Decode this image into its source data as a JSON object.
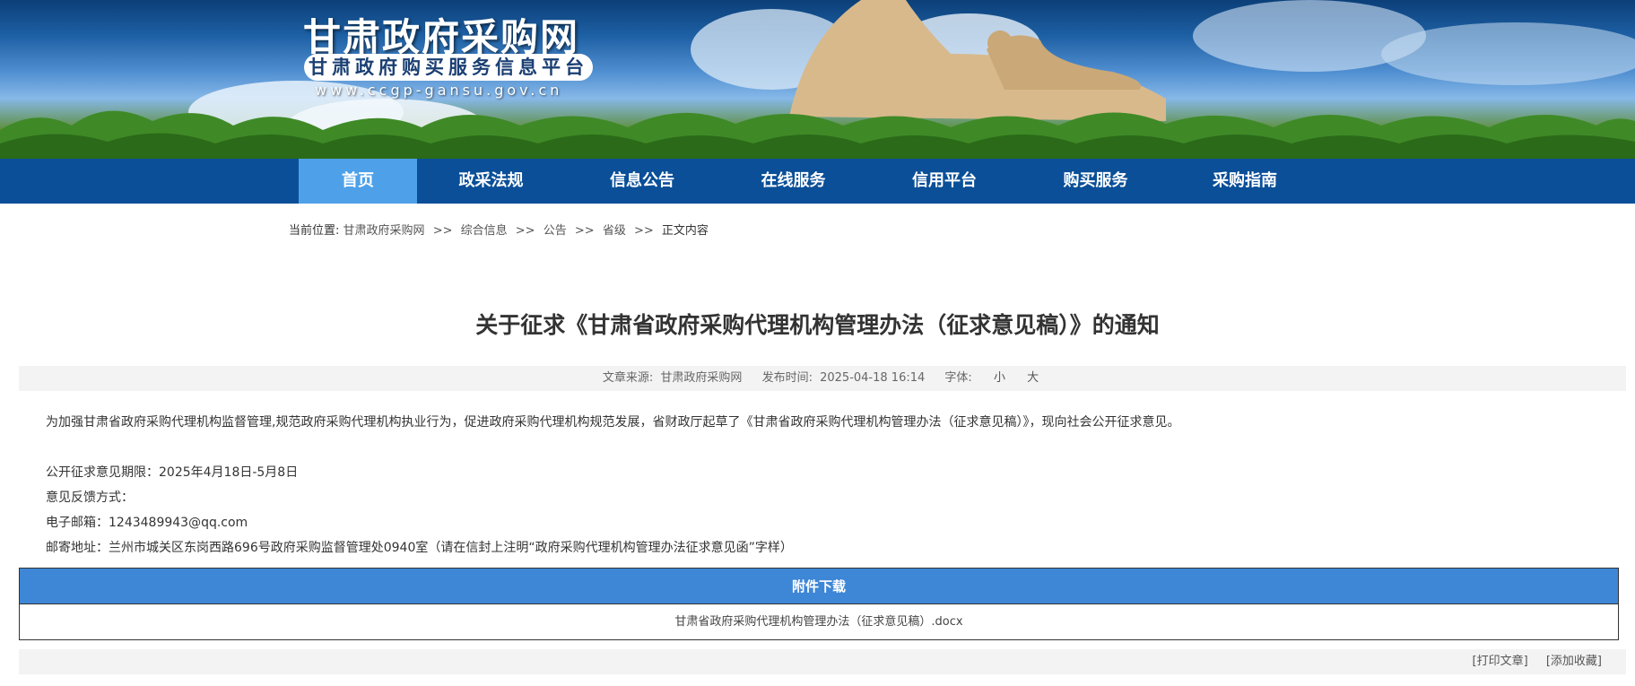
{
  "header": {
    "site_title": "甘肃政府采购网",
    "site_subtitle": "甘肃政府购买服务信息平台",
    "site_url": "www.ccgp-gansu.gov.cn"
  },
  "nav": {
    "items": [
      {
        "label": "首页",
        "active": true
      },
      {
        "label": "政采法规"
      },
      {
        "label": "信息公告"
      },
      {
        "label": "在线服务"
      },
      {
        "label": "信用平台"
      },
      {
        "label": "购买服务"
      },
      {
        "label": "采购指南"
      }
    ]
  },
  "breadcrumb": {
    "prefix": "当前位置:",
    "items": [
      "甘肃政府采购网",
      "综合信息",
      "公告",
      "省级"
    ],
    "separator": ">>",
    "current": "正文内容"
  },
  "article": {
    "title": "关于征求《甘肃省政府采购代理机构管理办法（征求意见稿）》的通知",
    "source_label": "文章来源:",
    "source": "甘肃政府采购网",
    "publish_label": "发布时间:",
    "publish_time": "2025-04-18 16:14",
    "font_label": "字体:",
    "font_small": "小",
    "font_large": "大",
    "paragraphs": [
      "为加强甘肃省政府采购代理机构监督管理,规范政府采购代理机构执业行为，促进政府采购代理机构规范发展，省财政厅起草了《甘肃省政府采购代理机构管理办法（征求意见稿）》，现向社会公开征求意见。",
      "公开征求意见期限：2025年4月18日-5月8日",
      "意见反馈方式：",
      "电子邮箱：1243489943@qq.com",
      "邮寄地址：兰州市城关区东岗西路696号政府采购监督管理处0940室（请在信封上注明“政府采购代理机构管理办法征求意见函”字样）"
    ]
  },
  "attachments": {
    "header": "附件下载",
    "files": [
      "甘肃省政府采购代理机构管理办法（征求意见稿）.docx"
    ]
  },
  "tools": {
    "print": "[打印文章]",
    "favorite": "[添加收藏]"
  },
  "colors": {
    "nav_bg": "#0a4f98",
    "nav_active": "#4ea1e8",
    "attach_header": "#3e86d6",
    "meta_bg": "#f3f3f3"
  }
}
